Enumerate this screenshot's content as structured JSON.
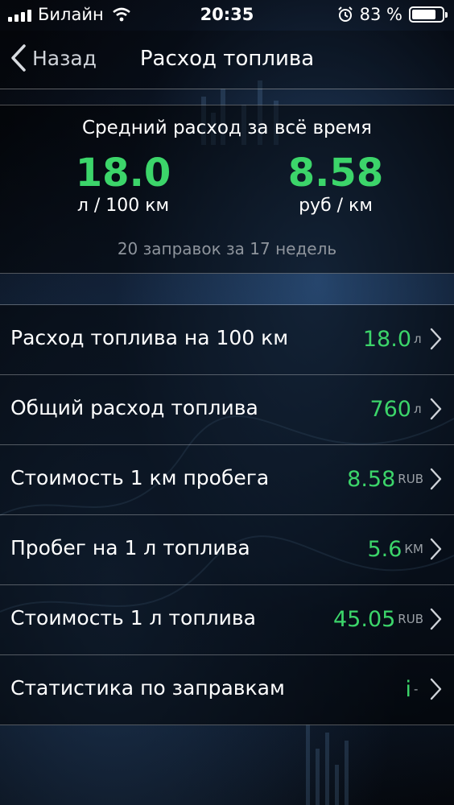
{
  "status_bar": {
    "carrier": "Билайн",
    "time": "20:35",
    "battery_percent": "83 %",
    "battery_level": 0.83
  },
  "nav": {
    "back_label": "Назад",
    "title": "Расход топлива"
  },
  "summary": {
    "title": "Средний расход за всё время",
    "left_value": "18.0",
    "left_unit": "л / 100 км",
    "right_value": "8.58",
    "right_unit": "руб / км",
    "note": "20 заправок за 17 недель"
  },
  "rows": [
    {
      "label": "Расход топлива на 100 км",
      "value": "18.0",
      "unit": "л"
    },
    {
      "label": "Общий расход топлива",
      "value": "760",
      "unit": "л"
    },
    {
      "label": "Стоимость 1 км пробега",
      "value": "8.58",
      "unit": "RUB"
    },
    {
      "label": "Пробег на 1 л топлива",
      "value": "5.6",
      "unit": "КМ"
    },
    {
      "label": "Стоимость 1 л топлива",
      "value": "45.05",
      "unit": "RUB"
    },
    {
      "label": "Статистика по заправкам",
      "value": "i",
      "unit": "-"
    }
  ],
  "colors": {
    "accent_green": "#3cd56a",
    "text": "#ffffff",
    "muted": "#8e949c"
  },
  "icons": {
    "signal": "signal-icon",
    "wifi": "wifi-icon",
    "alarm": "alarm-icon",
    "battery": "battery-icon",
    "back": "chevron-left-icon",
    "row": "chevron-right-icon"
  }
}
